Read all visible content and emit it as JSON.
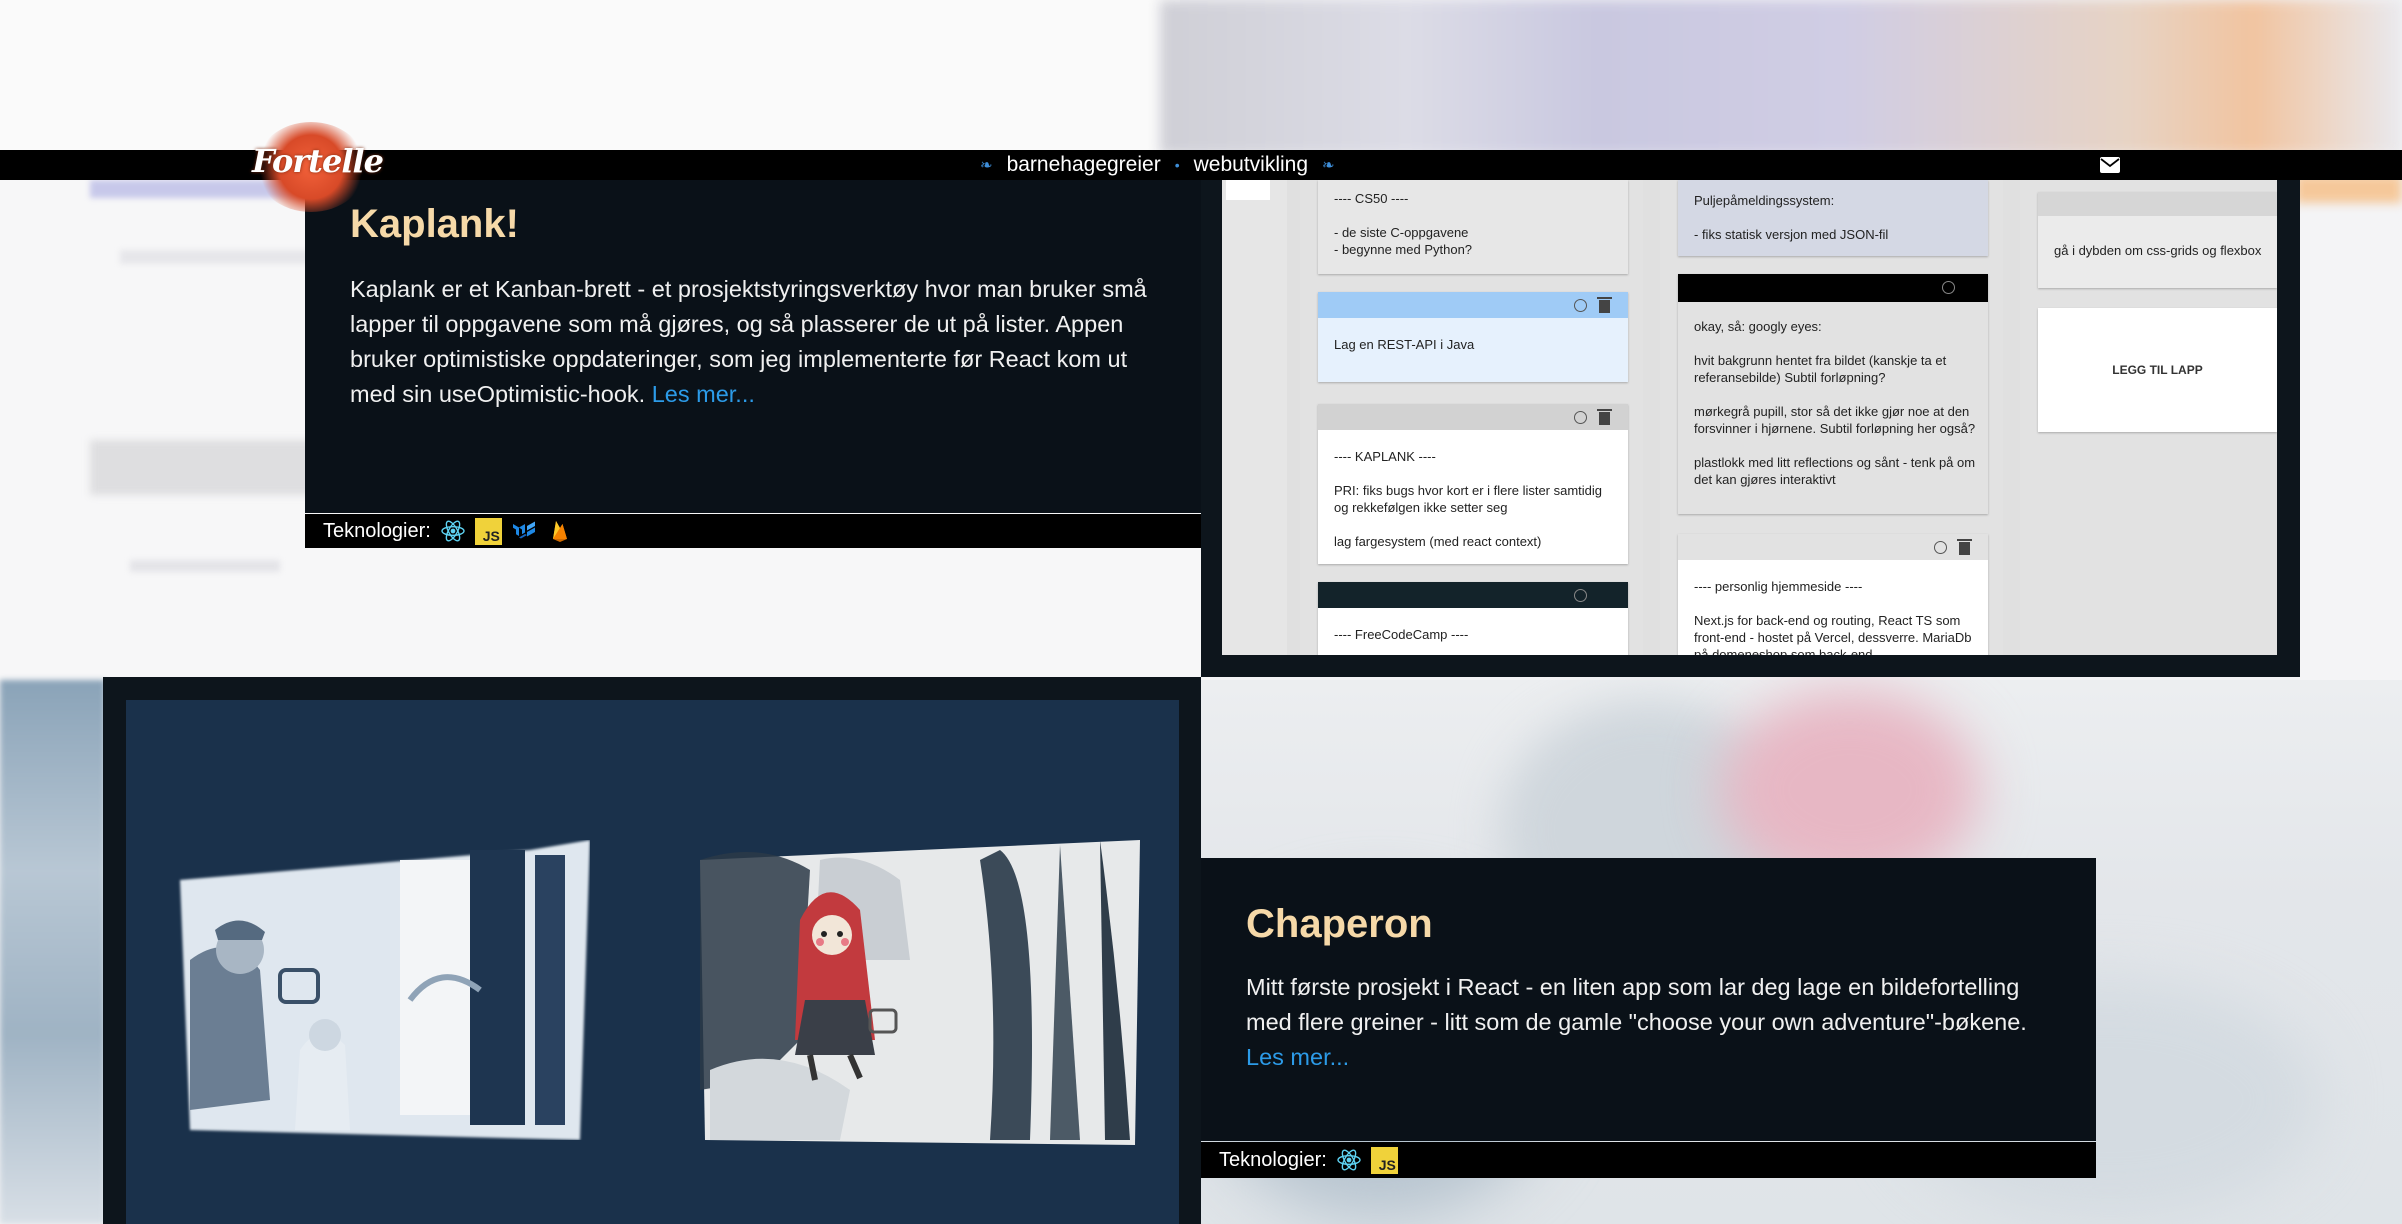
{
  "header": {
    "logo_text": "Fortelle",
    "nav": [
      {
        "label": "barnehagegreier"
      },
      {
        "label": "webutvikling"
      }
    ],
    "separator": "•",
    "mail_icon": "envelope-icon"
  },
  "kaplank": {
    "title": "Kaplank!",
    "description": "Kaplank er et Kanban-brett - et prosjektstyringsverktøy hvor man bruker små lapper til oppgavene som må gjøres, og så plasserer de ut på lister. Appen bruker optimistiske oppdateringer, som jeg implementerte før React kom ut med sin useOptimistic-hook.",
    "read_more": "Les mer...",
    "tech_label": "Teknologier:",
    "tech_icons": [
      "react-icon",
      "javascript-icon",
      "mui-icon",
      "firebase-icon"
    ],
    "js_badge": "JS",
    "screenshot": {
      "notes": [
        {
          "text": "---- CS50 ----\n\n- de siste C-oppgavene\n- begynne med Python?"
        },
        {
          "text": "Lag en REST-API i Java"
        },
        {
          "text": "---- KAPLANK ----\n\nPRI: fiks bugs hvor kort er i flere lister samtidig og rekkefølgen ikke setter seg\n\nlag fargesystem (med react context)"
        },
        {
          "text": "---- FreeCodeCamp ----"
        },
        {
          "text": "Puljepåmeldingssystem:\n\n- fiks statisk versjon med JSON-fil"
        },
        {
          "text": "okay, så: googly eyes:\n\nhvit bakgrunn hentet fra bildet (kanskje ta et referansebilde) Subtil forløpning?\n\nmørkegrå pupill, stor så det ikke gjør noe at den forsvinner i hjørnene. Subtil forløpning her også?\n\nplastlokk med litt reflections og sånt - tenk på om det kan gjøres interaktivt"
        },
        {
          "text": "---- personlig hjemmeside ----\n\nNext.js for back-end og routing, React TS som front-end - hostet på Vercel, dessverre. MariaDb på domeneshop som back-end"
        },
        {
          "text": "gå i dybden om css-grids og flexbox"
        },
        {
          "text": "LEGG TIL LAPP"
        }
      ]
    }
  },
  "chaperon": {
    "title": "Chaperon",
    "description": "Mitt første prosjekt i React - en liten app som lar deg lage en bildefortelling med flere greiner - litt som de gamle \"choose your own adventure\"-bøkene.",
    "read_more": "Les mer...",
    "tech_label": "Teknologier:",
    "tech_icons": [
      "react-icon",
      "javascript-icon"
    ],
    "js_badge": "JS"
  },
  "colors": {
    "accent_title": "#f6d9a8",
    "link": "#2c9be8",
    "card_bg": "#0a1118",
    "chaperon_panel": "#1a314b"
  }
}
